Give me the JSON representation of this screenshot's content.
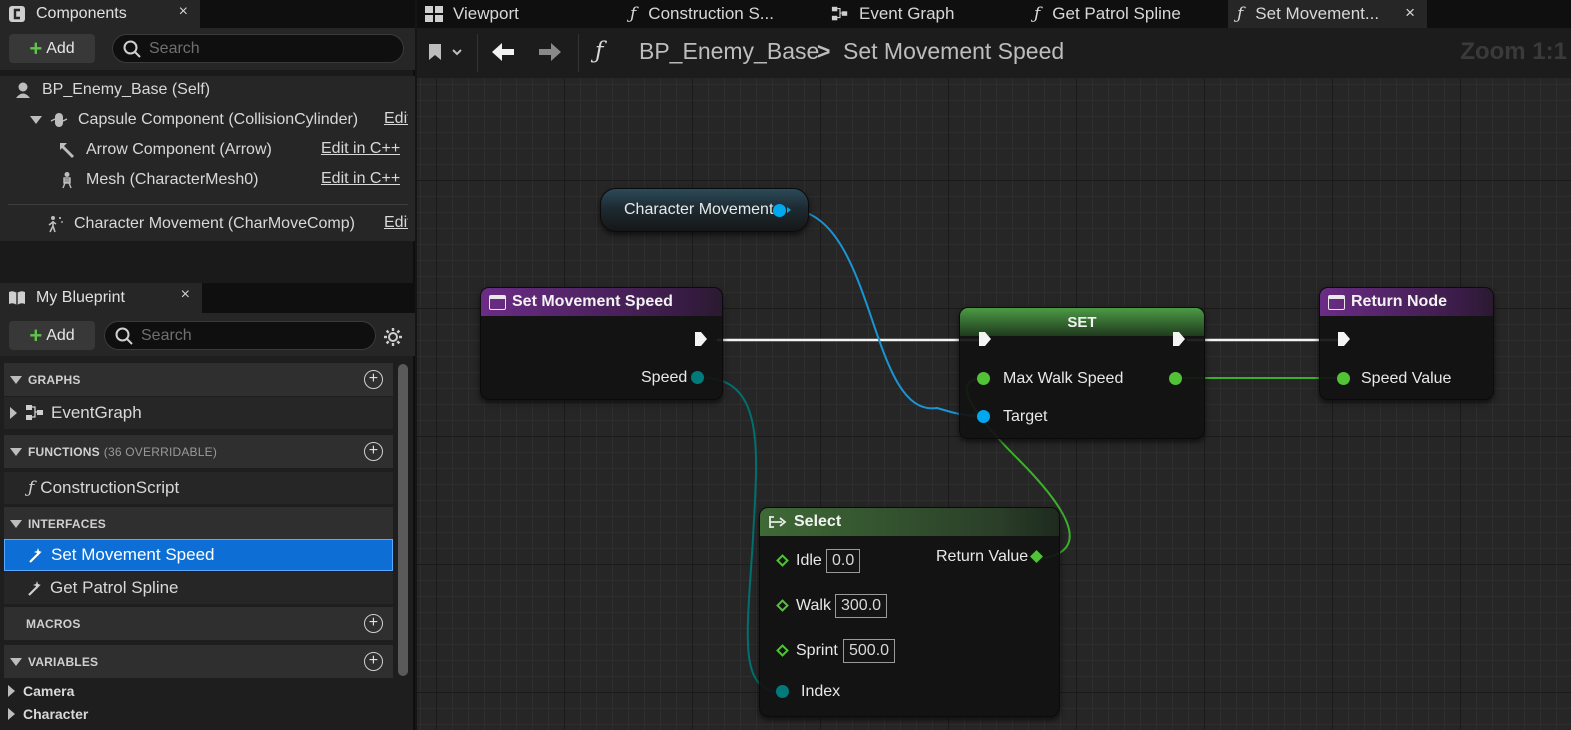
{
  "components_panel": {
    "tab_label": "Components",
    "close": "×",
    "add_label": "Add",
    "search_placeholder": "Search",
    "items": [
      {
        "label": "BP_Enemy_Base (Self)",
        "icon": "self-icon"
      },
      {
        "label": "Capsule Component (CollisionCylinder)",
        "edit": "Edit in C++",
        "icon": "capsule-icon"
      },
      {
        "label": "Arrow Component (Arrow)",
        "edit": "Edit in C++",
        "icon": "arrow-component-icon"
      },
      {
        "label": "Mesh (CharacterMesh0)",
        "edit": "Edit in C++",
        "icon": "skeletal-mesh-icon"
      },
      {
        "label": "Character Movement (CharMoveComp)",
        "edit": "Edit in C++",
        "icon": "movement-icon"
      }
    ]
  },
  "my_blueprint": {
    "tab_label": "My Blueprint",
    "close": "×",
    "add_label": "Add",
    "search_placeholder": "Search",
    "sections": {
      "graphs": "GRAPHS",
      "functions": "FUNCTIONS",
      "functions_sub": "(36 OVERRIDABLE)",
      "interfaces": "INTERFACES",
      "macros": "MACROS",
      "variables": "VARIABLES"
    },
    "graphs": [
      "EventGraph"
    ],
    "functions": [
      "ConstructionScript"
    ],
    "interfaces": [
      "Set Movement Speed",
      "Get Patrol Spline"
    ],
    "variable_categories": [
      "Camera",
      "Character"
    ]
  },
  "document_tabs": [
    {
      "label": "Viewport",
      "icon": "viewport-icon"
    },
    {
      "label": "Construction S...",
      "icon": "function-icon"
    },
    {
      "label": "Event Graph",
      "icon": "event-graph-icon"
    },
    {
      "label": "Get Patrol Spline",
      "icon": "function-icon"
    },
    {
      "label": "Set Movement...",
      "icon": "function-icon",
      "active": true
    }
  ],
  "graph_toolbar": {
    "blueprint": "BP_Enemy_Base",
    "separator": ">",
    "function": "Set Movement Speed",
    "zoom": "Zoom 1:1"
  },
  "nodes": {
    "character_movement": {
      "label": "Character Movement"
    },
    "entry": {
      "title": "Set Movement Speed",
      "out_pin": "Speed"
    },
    "set": {
      "title": "SET",
      "in_pin": "Max Walk Speed",
      "target_pin": "Target"
    },
    "return": {
      "title": "Return Node",
      "in_pin": "Speed Value"
    },
    "select": {
      "title": "Select",
      "options": [
        {
          "label": "Idle",
          "value": "0.0"
        },
        {
          "label": "Walk",
          "value": "300.0"
        },
        {
          "label": "Sprint",
          "value": "500.0"
        }
      ],
      "index_pin": "Index",
      "return_pin": "Return Value"
    }
  },
  "colors": {
    "selection": "#0d6fd6",
    "exec_wire": "#ffffff",
    "object_pin": "#00a8f0",
    "float_pin": "#52c236",
    "byte_pin": "#006b6b",
    "function_header": "#6b2c86",
    "pure_header": "#3e6a36"
  }
}
